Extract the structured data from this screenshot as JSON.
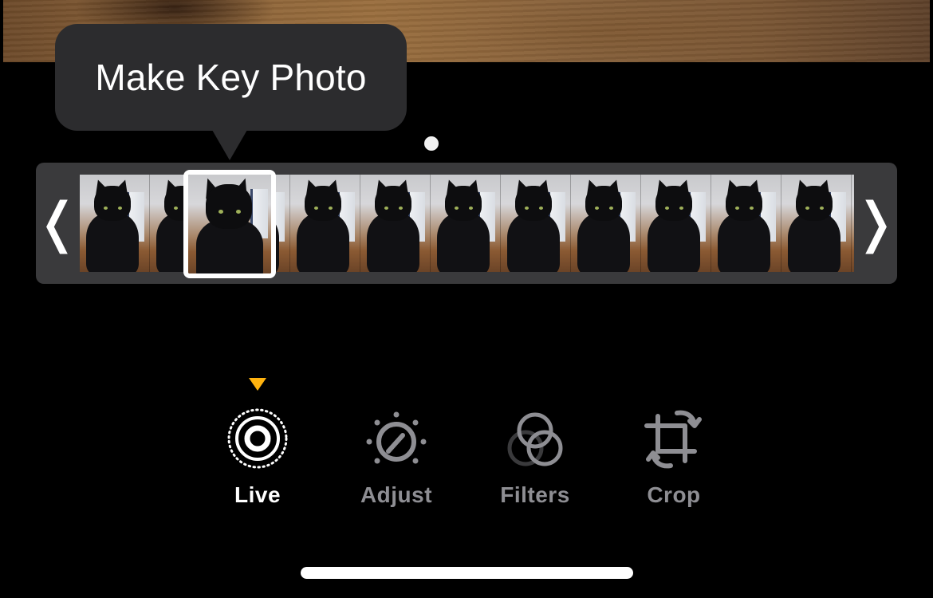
{
  "tooltip": {
    "text": "Make Key Photo"
  },
  "scrubber": {
    "left_handle_glyph": "❬",
    "right_handle_glyph": "❭",
    "frame_count": 12,
    "selected_frame_index": 2
  },
  "toolbar": {
    "active_tool": "live",
    "indicator_color": "#ffb30f",
    "tools": [
      {
        "id": "live",
        "label": "Live",
        "icon": "live-photo-icon"
      },
      {
        "id": "adjust",
        "label": "Adjust",
        "icon": "adjust-dial-icon"
      },
      {
        "id": "filters",
        "label": "Filters",
        "icon": "filters-circles-icon"
      },
      {
        "id": "crop",
        "label": "Crop",
        "icon": "crop-rotate-icon"
      }
    ]
  },
  "colors": {
    "background": "#000000",
    "tooltip_bg": "#2c2c2e",
    "scrubber_bg": "#3a3a3c",
    "active_label": "#ffffff",
    "inactive_label": "#8e8e93"
  }
}
